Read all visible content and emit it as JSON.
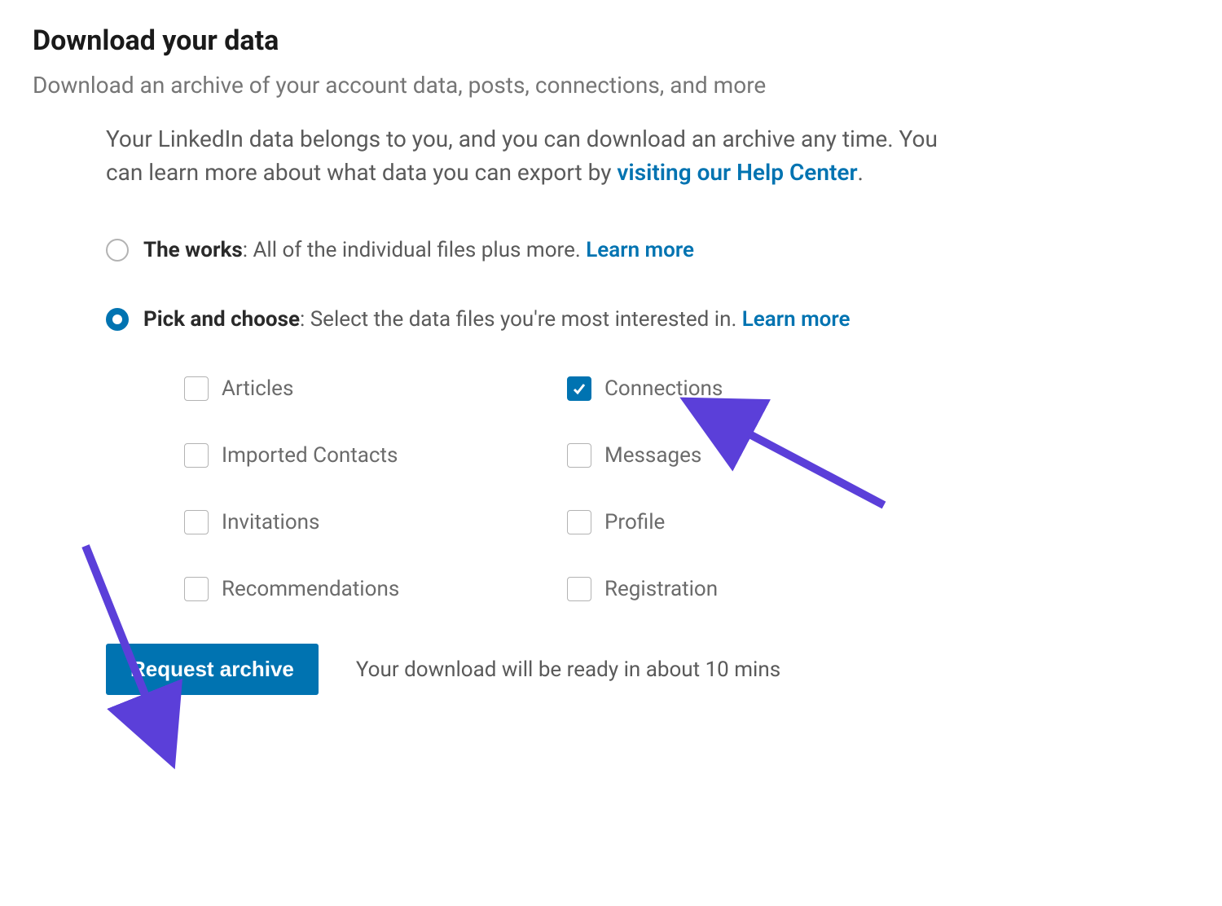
{
  "header": {
    "title": "Download your data",
    "subtitle": "Download an archive of your account data, posts, connections, and more"
  },
  "intro": {
    "text_part1": "Your LinkedIn data belongs to you, and you can download an archive any time. You can learn more about what data you can export by ",
    "link_text": "visiting our Help Center",
    "text_part2": "."
  },
  "options": {
    "the_works": {
      "title": "The works",
      "desc": ": All of the individual files plus more. ",
      "learn_more": "Learn more",
      "selected": false
    },
    "pick_and_choose": {
      "title": "Pick and choose",
      "desc": ": Select the data files you're most interested in. ",
      "learn_more": "Learn more",
      "selected": true
    }
  },
  "checkboxes": {
    "col1": [
      {
        "label": "Articles",
        "checked": false
      },
      {
        "label": "Imported Contacts",
        "checked": false
      },
      {
        "label": "Invitations",
        "checked": false
      },
      {
        "label": "Recommendations",
        "checked": false
      }
    ],
    "col2": [
      {
        "label": "Connections",
        "checked": true
      },
      {
        "label": "Messages",
        "checked": false
      },
      {
        "label": "Profile",
        "checked": false
      },
      {
        "label": "Registration",
        "checked": false
      }
    ]
  },
  "footer": {
    "button_label": "Request archive",
    "status_text": "Your download will be ready in about 10 mins"
  },
  "annotation": {
    "arrow_color": "#5b3fd9"
  }
}
